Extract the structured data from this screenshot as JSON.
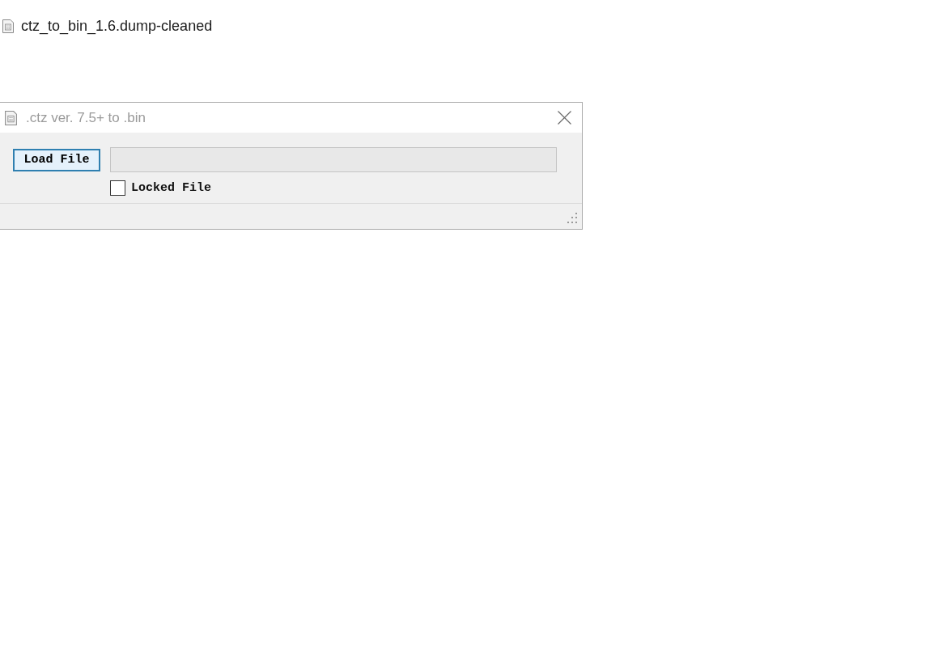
{
  "file": {
    "name": "ctz_to_bin_1.6.dump-cleaned"
  },
  "window": {
    "title": ".ctz ver. 7.5+ to .bin"
  },
  "load_button": {
    "label": "Load File",
    "focused": true
  },
  "path_field": {
    "disabled": true
  },
  "locked_file": {
    "label": "Locked File",
    "checked": false
  }
}
